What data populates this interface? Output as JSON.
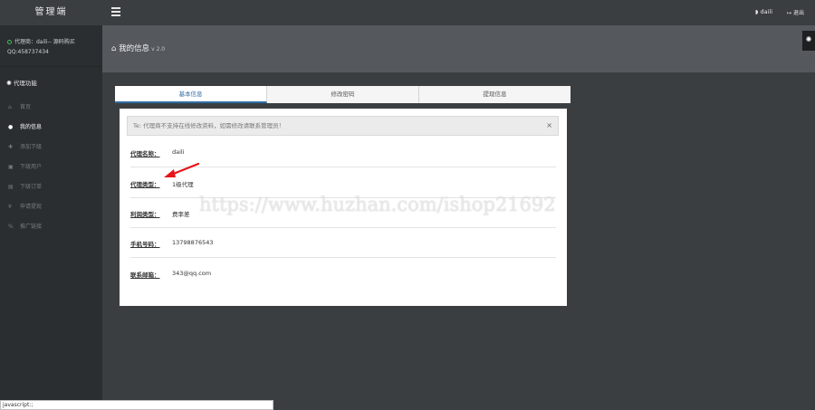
{
  "brand": "管理端",
  "agent": {
    "line1": "代理商：daili-- 源码购买",
    "line2": "QQ:458737434"
  },
  "menu_title": "代理功能",
  "menu": [
    {
      "label": "首页",
      "icon": "home-icon",
      "glyph": "⌂"
    },
    {
      "label": "我的信息",
      "icon": "user-icon",
      "glyph": "●"
    },
    {
      "label": "添加下级",
      "icon": "add-user-icon",
      "glyph": "✚"
    },
    {
      "label": "下级用户",
      "icon": "users-icon",
      "glyph": "▣"
    },
    {
      "label": "下级订单",
      "icon": "order-icon",
      "glyph": "▤"
    },
    {
      "label": "申请提现",
      "icon": "yen-icon",
      "glyph": "¥"
    },
    {
      "label": "推广链接",
      "icon": "link-icon",
      "glyph": "%"
    }
  ],
  "topbar": {
    "user": "daili",
    "logout": "退出"
  },
  "page": {
    "title": "我的信息",
    "version": "v 2.0"
  },
  "tabs": [
    "基本信息",
    "修改密码",
    "提现信息"
  ],
  "alert": {
    "text": "Te: 代理商不支持在线修改资料，如需修改请联系管理员！",
    "close": "×"
  },
  "fields": [
    {
      "label": "代理名称：",
      "value": "daili"
    },
    {
      "label": "代理类型：",
      "value": "1级代理"
    },
    {
      "label": "利润类型：",
      "value": "费率差"
    },
    {
      "label": "手机号码：",
      "value": "13798876543"
    },
    {
      "label": "联系邮箱：",
      "value": "343@qq.com"
    }
  ],
  "watermark": "https://www.huzhan.com/ishop21692",
  "status_bar": "javascript:;",
  "colors": {
    "sidebar": "#2b2e31",
    "topbar": "#3b3e41",
    "accent": "#2e6da4",
    "online": "#3cbf52",
    "arrow": "#e8141b"
  }
}
